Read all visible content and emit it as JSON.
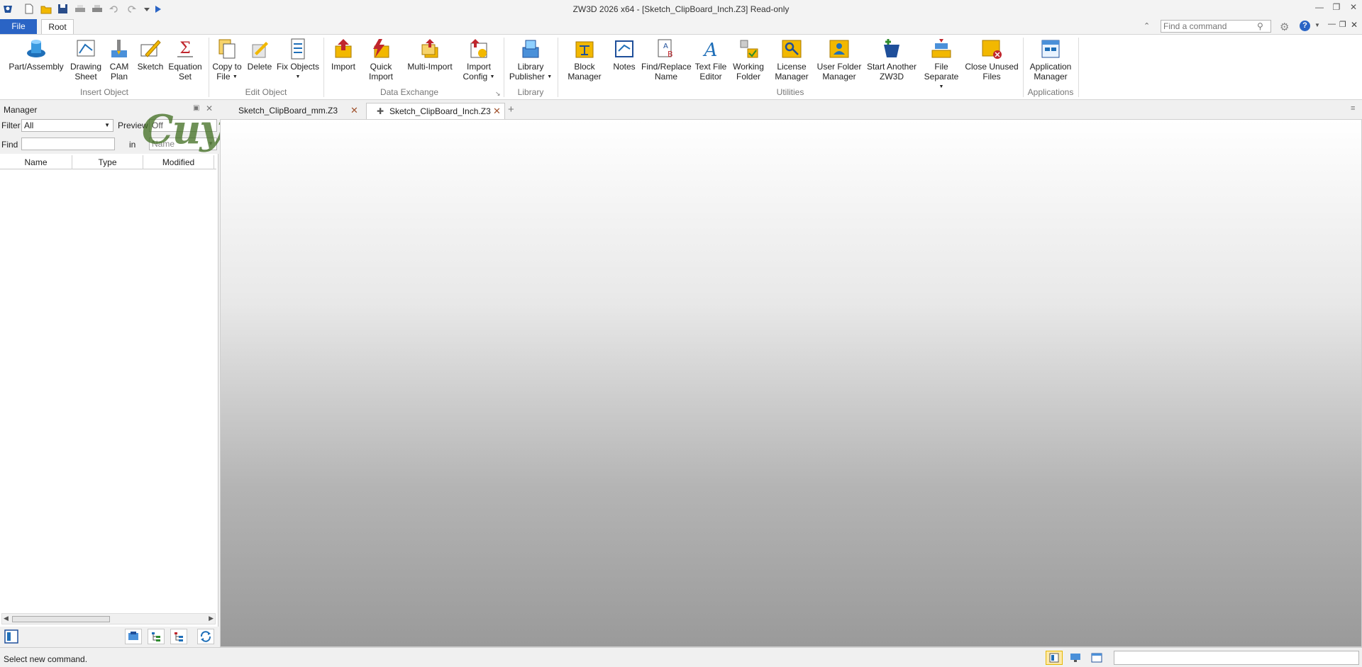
{
  "window": {
    "title": "ZW3D 2026 x64  - [Sketch_ClipBoard_Inch.Z3] Read-only",
    "controls": [
      "minimize",
      "restore",
      "close"
    ]
  },
  "quick_access": [
    "new",
    "open",
    "save",
    "print",
    "print-preview",
    "undo",
    "redo",
    "customize",
    "run"
  ],
  "ribbon_tabs": {
    "file": "File",
    "root": "Root"
  },
  "command_search": {
    "placeholder": "Find a command"
  },
  "ribbon": {
    "groups": [
      {
        "label": "Insert Object",
        "buttons": [
          {
            "line1": "Part/Assembly",
            "line2": "",
            "icon": "part-assembly-icon"
          },
          {
            "line1": "Drawing",
            "line2": "Sheet",
            "icon": "drawing-sheet-icon"
          },
          {
            "line1": "CAM",
            "line2": "Plan",
            "icon": "cam-plan-icon"
          },
          {
            "line1": "Sketch",
            "line2": "",
            "icon": "sketch-icon"
          },
          {
            "line1": "Equation",
            "line2": "Set",
            "icon": "equation-set-icon"
          }
        ]
      },
      {
        "label": "Edit Object",
        "buttons": [
          {
            "line1": "Copy to",
            "line2": "File",
            "icon": "copy-to-file-icon"
          },
          {
            "line1": "Delete",
            "line2": "",
            "icon": "delete-icon"
          },
          {
            "line1": "Fix Objects",
            "line2": "",
            "icon": "fix-objects-icon"
          }
        ]
      },
      {
        "label": "Data Exchange",
        "buttons": [
          {
            "line1": "Import",
            "line2": "",
            "icon": "import-icon"
          },
          {
            "line1": "Quick",
            "line2": "Import",
            "icon": "quick-import-icon"
          },
          {
            "line1": "Multi-Import",
            "line2": "",
            "icon": "multi-import-icon"
          },
          {
            "line1": "Import",
            "line2": "Config",
            "icon": "import-config-icon"
          }
        ]
      },
      {
        "label": "Library",
        "buttons": [
          {
            "line1": "Library",
            "line2": "Publisher",
            "icon": "library-publisher-icon"
          }
        ]
      },
      {
        "label": "Utilities",
        "buttons": [
          {
            "line1": "Block",
            "line2": "Manager",
            "icon": "block-manager-icon"
          },
          {
            "line1": "Notes",
            "line2": "",
            "icon": "notes-icon"
          },
          {
            "line1": "Find/Replace",
            "line2": "Name",
            "icon": "find-replace-icon"
          },
          {
            "line1": "Text File",
            "line2": "Editor",
            "icon": "text-file-editor-icon"
          },
          {
            "line1": "Working",
            "line2": "Folder",
            "icon": "working-folder-icon"
          },
          {
            "line1": "License",
            "line2": "Manager",
            "icon": "license-manager-icon"
          },
          {
            "line1": "User Folder",
            "line2": "Manager",
            "icon": "user-folder-icon"
          },
          {
            "line1": "Start Another",
            "line2": "ZW3D",
            "icon": "start-another-icon"
          },
          {
            "line1": "File",
            "line2": "Separate",
            "icon": "file-separate-icon"
          },
          {
            "line1": "Close Unused",
            "line2": "Files",
            "icon": "close-unused-icon"
          }
        ]
      },
      {
        "label": "Applications",
        "buttons": [
          {
            "line1": "Application",
            "line2": "Manager",
            "icon": "application-manager-icon"
          }
        ]
      }
    ]
  },
  "manager": {
    "title": "Manager",
    "filter_label": "Filter",
    "filter_value": "All",
    "preview_label": "Preview",
    "preview_value": "Off",
    "find_label": "Find",
    "in_label": "in",
    "in_value": "Name",
    "columns": [
      "Name",
      "Type",
      "Modified"
    ]
  },
  "documents": {
    "tabs": [
      {
        "label": "Sketch_ClipBoard_mm.Z3",
        "active": false
      },
      {
        "label": "Sketch_ClipBoard_Inch.Z3",
        "active": true
      }
    ]
  },
  "status": {
    "text": "Select new command."
  },
  "watermark": {
    "text": "CuyhAaMe"
  },
  "colors": {
    "file_tab": "#2a64c5",
    "accent_close": "#a0522d"
  }
}
